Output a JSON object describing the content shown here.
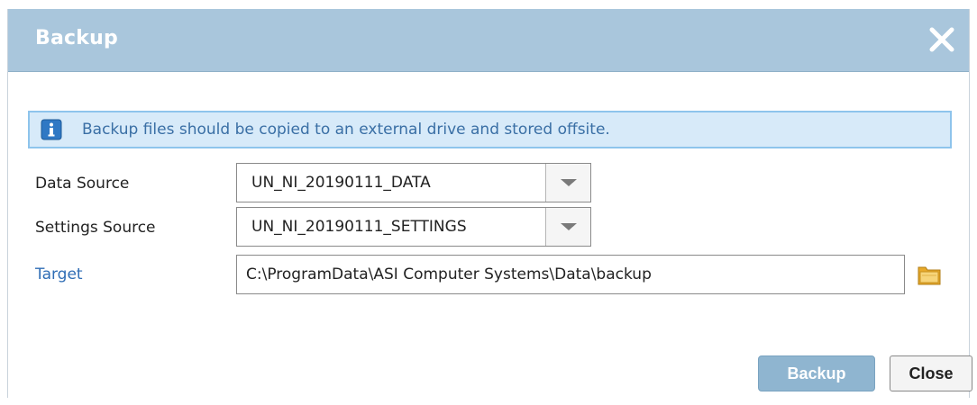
{
  "dialog": {
    "title": "Backup"
  },
  "info": {
    "message": "Backup files should be copied to an external drive and stored offsite."
  },
  "form": {
    "data_source": {
      "label": "Data Source",
      "value": "UN_NI_20190111_DATA"
    },
    "settings_source": {
      "label": "Settings Source",
      "value": "UN_NI_20190111_SETTINGS"
    },
    "target": {
      "label": "Target",
      "value": "C:\\ProgramData\\ASI Computer Systems\\Data\\backup"
    }
  },
  "buttons": {
    "backup": "Backup",
    "close": "Close"
  },
  "colors": {
    "titlebar": "#a9c6dc",
    "banner_bg": "#d7eaf9",
    "banner_border": "#8ec4ec",
    "link": "#2f6db5",
    "primary_button": "#8fb5d0"
  },
  "icons": {
    "close": "close-icon",
    "info": "info-icon",
    "dropdown": "chevron-down-icon",
    "folder": "folder-icon"
  }
}
